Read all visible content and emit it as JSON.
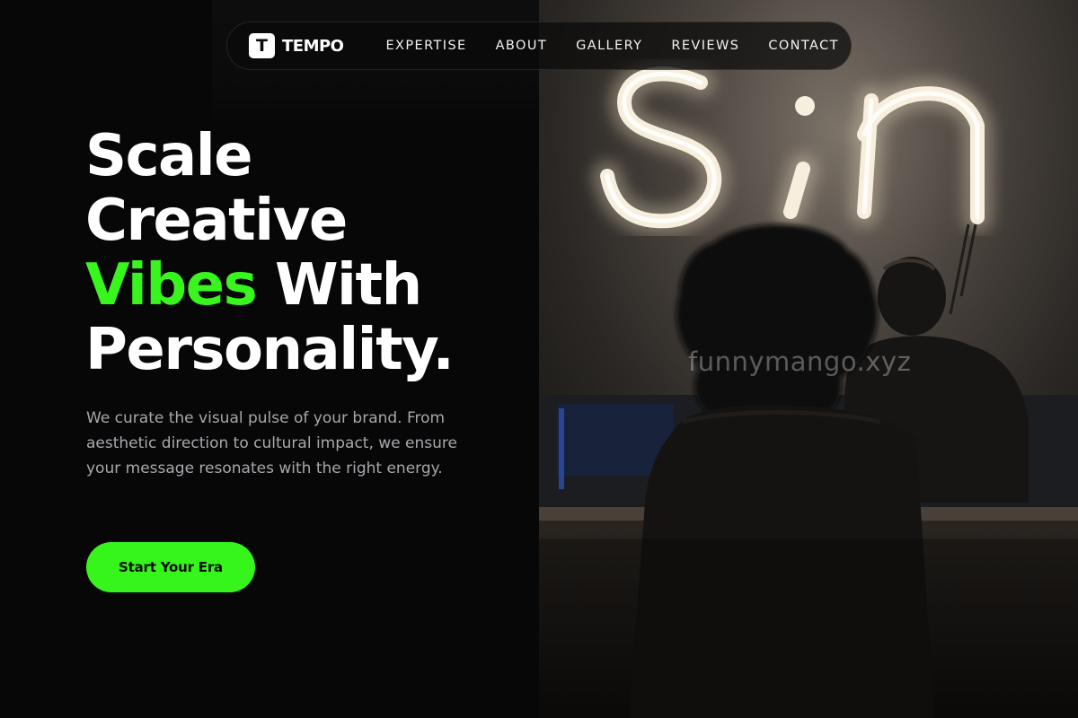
{
  "brand": {
    "logo_letter": "T",
    "name": "TEMPO"
  },
  "nav": {
    "links": [
      "EXPERTISE",
      "ABOUT",
      "GALLERY",
      "REVIEWS",
      "CONTACT"
    ]
  },
  "hero": {
    "title_line1": "Scale",
    "title_line2": "Creative",
    "title_accent": "Vibes",
    "title_line3_rest": "With",
    "title_line4": "Personality.",
    "description": "We curate the visual pulse of your brand. From aesthetic direction to cultural impact, we ensure your message resonates with the right energy.",
    "cta_label": "Start Your Era"
  },
  "photo": {
    "neon_text": "Sin",
    "watermark": "funnymango.xyz"
  },
  "colors": {
    "accent": "#39F51E",
    "background": "#070707",
    "text_muted": "#A6A8AD"
  }
}
